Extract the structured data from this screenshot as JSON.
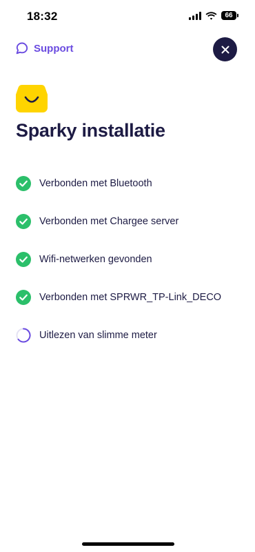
{
  "status_bar": {
    "time": "18:32",
    "battery_level": "66"
  },
  "header": {
    "support_label": "Support",
    "close_icon": "close-icon",
    "support_icon": "chat-bubble-icon"
  },
  "title": "Sparky installatie",
  "steps": [
    {
      "label": "Verbonden met Bluetooth",
      "state": "done"
    },
    {
      "label": "Verbonden met Chargee server",
      "state": "done"
    },
    {
      "label": "Wifi-netwerken gevonden",
      "state": "done"
    },
    {
      "label": "Verbonden met SPRWR_TP-Link_DECO",
      "state": "done"
    },
    {
      "label": "Uitlezen van slimme meter",
      "state": "in-progress"
    }
  ],
  "colors": {
    "accent": "#6a4be0",
    "dark": "#1d1b44",
    "success": "#2bbf6a",
    "logo_yellow": "#ffd400"
  }
}
